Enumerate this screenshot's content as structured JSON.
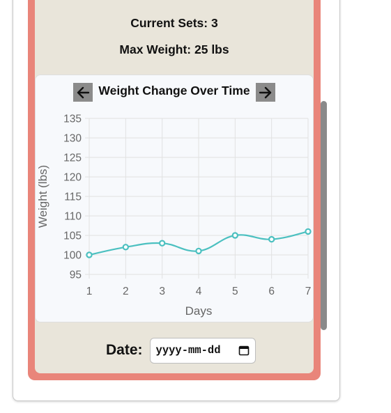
{
  "stats": {
    "current_sets": "Current Sets: 3",
    "max_weight": "Max Weight: 25 lbs"
  },
  "chart_card": {
    "prev_icon": "arrow-left-icon",
    "next_icon": "arrow-right-icon"
  },
  "chart_data": {
    "type": "line",
    "title": "Weight Change Over Time",
    "xlabel": "Days",
    "ylabel": "Weight (lbs)",
    "x": [
      1,
      2,
      3,
      4,
      5,
      6,
      7
    ],
    "series": [
      {
        "values": [
          100,
          102,
          103,
          101,
          105,
          104,
          106
        ]
      }
    ],
    "ylim": [
      95,
      135
    ],
    "yticks": [
      95,
      100,
      105,
      110,
      115,
      120,
      125,
      130,
      135
    ],
    "grid": true,
    "legend": "none",
    "line_color": "#4bc0c0"
  },
  "date": {
    "label": "Date:",
    "placeholder": "yyyy-mm-dd",
    "icon": "calendar-icon"
  },
  "colors": {
    "card_border": "#e9857a",
    "card_bg": "#e9e5da",
    "chart_bg": "#f7f9fc"
  }
}
